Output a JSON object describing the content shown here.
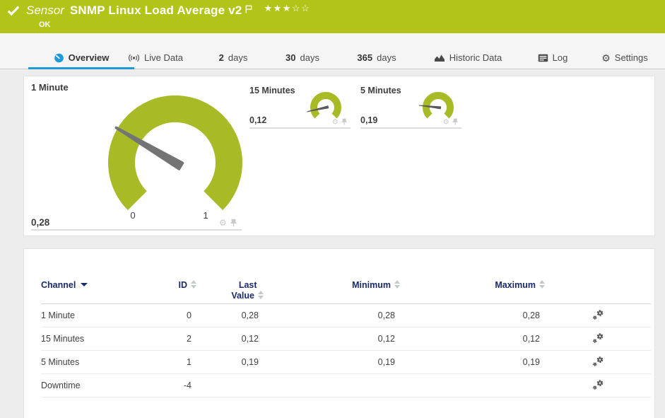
{
  "header": {
    "kind_label": "Sensor",
    "title": "SNMP Linux Load Average v2",
    "status": "OK",
    "rating_stars": "★★★☆☆",
    "rating": {
      "filled": 3,
      "total": 5
    }
  },
  "icons": {
    "gear": "⚙"
  },
  "colors": {
    "brand_green": "#b3c418",
    "gauge_green": "#a8ba26",
    "active_blue": "#1e9ad8",
    "header_navy": "#1b2a6b"
  },
  "tabs": [
    {
      "label": "Overview",
      "icon": "gauge-icon",
      "active": true
    },
    {
      "label": "Live Data",
      "icon": "broadcast-icon",
      "active": false
    },
    {
      "prefix": "2",
      "label": "days",
      "active": false
    },
    {
      "prefix": "30",
      "label": "days",
      "active": false
    },
    {
      "prefix": "365",
      "label": "days",
      "active": false
    },
    {
      "label": "Historic Data",
      "icon": "area-chart-icon",
      "active": false
    },
    {
      "label": "Log",
      "icon": "log-icon",
      "active": false
    },
    {
      "label": "Settings",
      "icon": "gear-icon",
      "active": false
    }
  ],
  "gauges": {
    "main": {
      "label": "1 Minute",
      "value": "0,28",
      "value_num": 0.28,
      "min_label": "0",
      "max_label": "1"
    },
    "small": [
      {
        "label": "15 Minutes",
        "value": "0,12",
        "value_num": 0.12
      },
      {
        "label": "5 Minutes",
        "value": "0,19",
        "value_num": 0.19
      }
    ]
  },
  "chart_data": [
    {
      "type": "gauge",
      "title": "1 Minute",
      "value": 0.28,
      "min": 0,
      "max": 1
    },
    {
      "type": "gauge",
      "title": "15 Minutes",
      "value": 0.12,
      "min": 0,
      "max": 1
    },
    {
      "type": "gauge",
      "title": "5 Minutes",
      "value": 0.19,
      "min": 0,
      "max": 1
    }
  ],
  "table": {
    "header": {
      "channel": "Channel",
      "id": "ID",
      "last_line1": "Last",
      "last_line2": "Value",
      "minimum": "Minimum",
      "maximum": "Maximum"
    },
    "rows": [
      {
        "channel": "1 Minute",
        "id": "0",
        "last": "0,28",
        "min": "0,28",
        "max": "0,28"
      },
      {
        "channel": "15 Minutes",
        "id": "2",
        "last": "0,12",
        "min": "0,12",
        "max": "0,12"
      },
      {
        "channel": "5 Minutes",
        "id": "1",
        "last": "0,19",
        "min": "0,19",
        "max": "0,19"
      },
      {
        "channel": "Downtime",
        "id": "-4",
        "last": "",
        "min": "",
        "max": ""
      }
    ]
  }
}
